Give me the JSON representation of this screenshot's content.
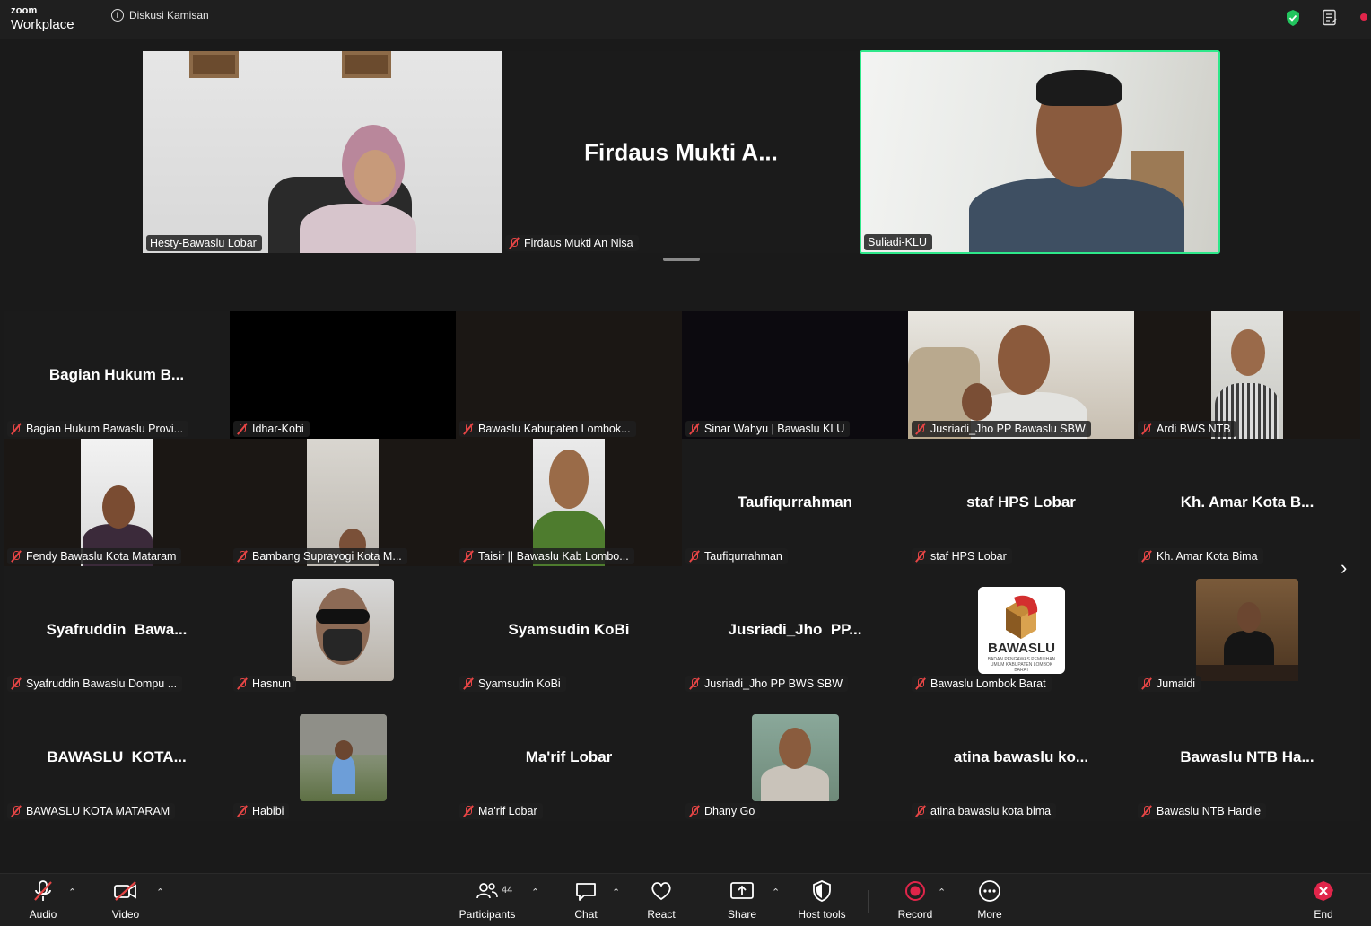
{
  "app": {
    "brand_small": "zoom",
    "brand_large": "Workplace"
  },
  "meeting": {
    "title": "Diskusi Kamisan"
  },
  "top_row": [
    {
      "label": "Hesty-Bawaslu Lobar"
    },
    {
      "name": "Firdaus Mukti A...",
      "label": "Firdaus Mukti An Nisa"
    },
    {
      "label": "Suliadi-KLU"
    }
  ],
  "gallery": [
    {
      "name": "Bagian Hukum B...",
      "label": "Bagian Hukum Bawaslu Provi..."
    },
    {
      "label": "Idhar-Kobi"
    },
    {
      "label": "Bawaslu Kabupaten Lombok..."
    },
    {
      "label": "Sinar Wahyu | Bawaslu KLU"
    },
    {
      "label": "Jusriadi_Jho PP Bawaslu SBW"
    },
    {
      "label": "Ardi BWS NTB"
    },
    {
      "label": "Fendy Bawaslu Kota Mataram"
    },
    {
      "label": "Bambang Suprayogi Kota M..."
    },
    {
      "label": "Taisir || Bawaslu Kab Lombo..."
    },
    {
      "name": "Taufiqurrahman",
      "label": "Taufiqurrahman"
    },
    {
      "name": "staf HPS Lobar",
      "label": "staf HPS Lobar"
    },
    {
      "name": "Kh. Amar Kota B...",
      "label": "Kh. Amar Kota Bima"
    },
    {
      "name": "Syafruddin  Bawa...",
      "label": "Syafruddin Bawaslu Dompu ..."
    },
    {
      "label": "Hasnun"
    },
    {
      "name": "Syamsudin KoBi",
      "label": "Syamsudin KoBi"
    },
    {
      "name": "Jusriadi_Jho  PP...",
      "label": "Jusriadi_Jho PP BWS SBW"
    },
    {
      "label": "Bawaslu Lombok Barat",
      "logo_text": "BAWASLU",
      "logo_sub": "BADAN PENGAWAS PEMILIHAN UMUM KABUPATEN LOMBOK BARAT"
    },
    {
      "label": "Jumaidi"
    },
    {
      "name": "BAWASLU  KOTA...",
      "label": "BAWASLU KOTA MATARAM"
    },
    {
      "label": "Habibi"
    },
    {
      "name": "Ma'rif Lobar",
      "label": "Ma'rif Lobar"
    },
    {
      "label": "Dhany Go"
    },
    {
      "name": "atina bawaslu ko...",
      "label": "atina bawaslu kota bima"
    },
    {
      "name": "Bawaslu NTB Ha...",
      "label": "Bawaslu NTB Hardie"
    }
  ],
  "toolbar": {
    "audio": "Audio",
    "video": "Video",
    "participants": "Participants",
    "participants_count": "44",
    "chat": "Chat",
    "react": "React",
    "share": "Share",
    "host_tools": "Host tools",
    "record": "Record",
    "more": "More",
    "end": "End"
  },
  "colors": {
    "accent_green": "#2ee88a",
    "mute_red": "#e54545",
    "end_red": "#e0254a"
  }
}
